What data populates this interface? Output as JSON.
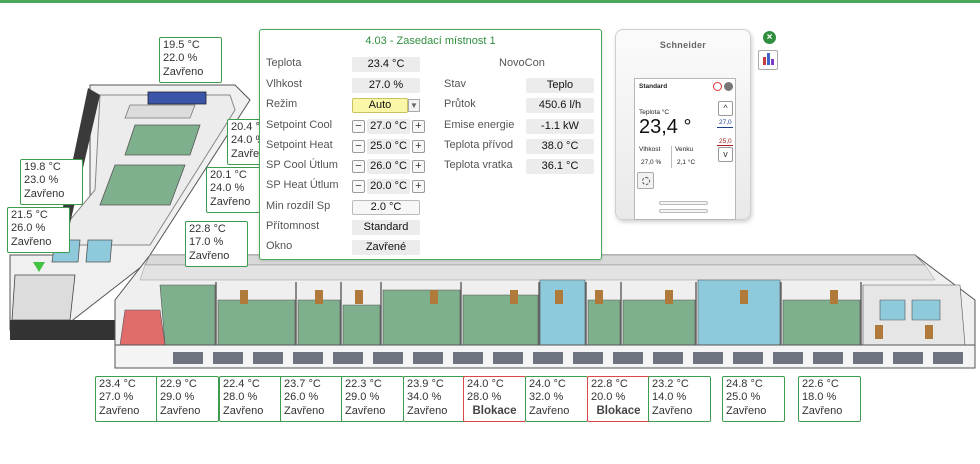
{
  "panel": {
    "title": "4.03 - Zasedací místnost 1",
    "right_title": "NovoCon",
    "fields": [
      {
        "label": "Teplota",
        "value": "23.4 °C"
      },
      {
        "label": "Vlhkost",
        "value": "27.0 %"
      },
      {
        "label": "Režim",
        "value": "Auto"
      },
      {
        "label": "Setpoint Cool",
        "value": "27.0 °C"
      },
      {
        "label": "Setpoint Heat",
        "value": "25.0 °C"
      },
      {
        "label": "SP Cool Útlum",
        "value": "26.0 °C"
      },
      {
        "label": "SP Heat Útlum",
        "value": "20.0 °C"
      },
      {
        "label": "Min rozdíl Sp",
        "value": "2.0 °C"
      },
      {
        "label": "Přítomnost",
        "value": "Standard"
      },
      {
        "label": "Okno",
        "value": "Zavřené"
      }
    ],
    "right_fields": [
      {
        "label": "Stav",
        "value": "Teplo"
      },
      {
        "label": "Průtok",
        "value": "450.6 l/h"
      },
      {
        "label": "Emise energie",
        "value": "-1.1 kW"
      },
      {
        "label": "Teplota přívod",
        "value": "38.0 °C"
      },
      {
        "label": "Teplota vratka",
        "value": "36.1 °C"
      }
    ],
    "minus": "−",
    "plus": "+",
    "dropdown_arrow": "▼"
  },
  "thermostat": {
    "brand": "Schneider",
    "mode": "Standard",
    "temp_label": "Teplota °C",
    "temp_value": "23,4 °",
    "sp_cool": "27,0",
    "sp_heat": "25,0",
    "hum_label": "Vlhkost",
    "hum_value": "27,0 %",
    "out_label": "Venku",
    "out_value": "2,1 °C",
    "up": "^",
    "down": "v"
  },
  "icons": {
    "close": "close-icon",
    "chart": "bar-chart-icon"
  },
  "colors": {
    "accent": "#3c9b4e",
    "block": "#d94848",
    "room_green": "#7fb08e",
    "room_blue": "#8ec9dc",
    "room_red": "#e06c6c"
  },
  "rooms": [
    {
      "temp": "19.5 °C",
      "hum": "22.0 %",
      "status": "Zavřeno",
      "blocked": false
    },
    {
      "temp": "20.4 °C",
      "hum": "24.0 %",
      "status": "Zavřeno",
      "blocked": false
    },
    {
      "temp": "20.1 °C",
      "hum": "24.0 %",
      "status": "Zavřeno",
      "blocked": false
    },
    {
      "temp": "19.8 °C",
      "hum": "23.0 %",
      "status": "Zavřeno",
      "blocked": false
    },
    {
      "temp": "21.5 °C",
      "hum": "26.0 %",
      "status": "Zavřeno",
      "blocked": false
    },
    {
      "temp": "22.8 °C",
      "hum": "17.0 %",
      "status": "Zavřeno",
      "blocked": false
    },
    {
      "temp": "23.4 °C",
      "hum": "27.0 %",
      "status": "Zavřeno",
      "blocked": false
    },
    {
      "temp": "22.9 °C",
      "hum": "29.0 %",
      "status": "Zavřeno",
      "blocked": false
    },
    {
      "temp": "22.4 °C",
      "hum": "28.0 %",
      "status": "Zavřeno",
      "blocked": false
    },
    {
      "temp": "23.7 °C",
      "hum": "26.0 %",
      "status": "Zavřeno",
      "blocked": false
    },
    {
      "temp": "22.3 °C",
      "hum": "29.0 %",
      "status": "Zavřeno",
      "blocked": false
    },
    {
      "temp": "23.9 °C",
      "hum": "34.0 %",
      "status": "Zavřeno",
      "blocked": false
    },
    {
      "temp": "24.0 °C",
      "hum": "28.0 %",
      "status": "Blokace",
      "blocked": true
    },
    {
      "temp": "24.0 °C",
      "hum": "32.0 %",
      "status": "Zavřeno",
      "blocked": false
    },
    {
      "temp": "22.8 °C",
      "hum": "20.0 %",
      "status": "Blokace",
      "blocked": true
    },
    {
      "temp": "23.2 °C",
      "hum": "14.0 %",
      "status": "Zavřeno",
      "blocked": false
    },
    {
      "temp": "24.8 °C",
      "hum": "25.0 %",
      "status": "Zavřeno",
      "blocked": false
    },
    {
      "temp": "22.6 °C",
      "hum": "18.0 %",
      "status": "Zavřeno",
      "blocked": false
    }
  ]
}
